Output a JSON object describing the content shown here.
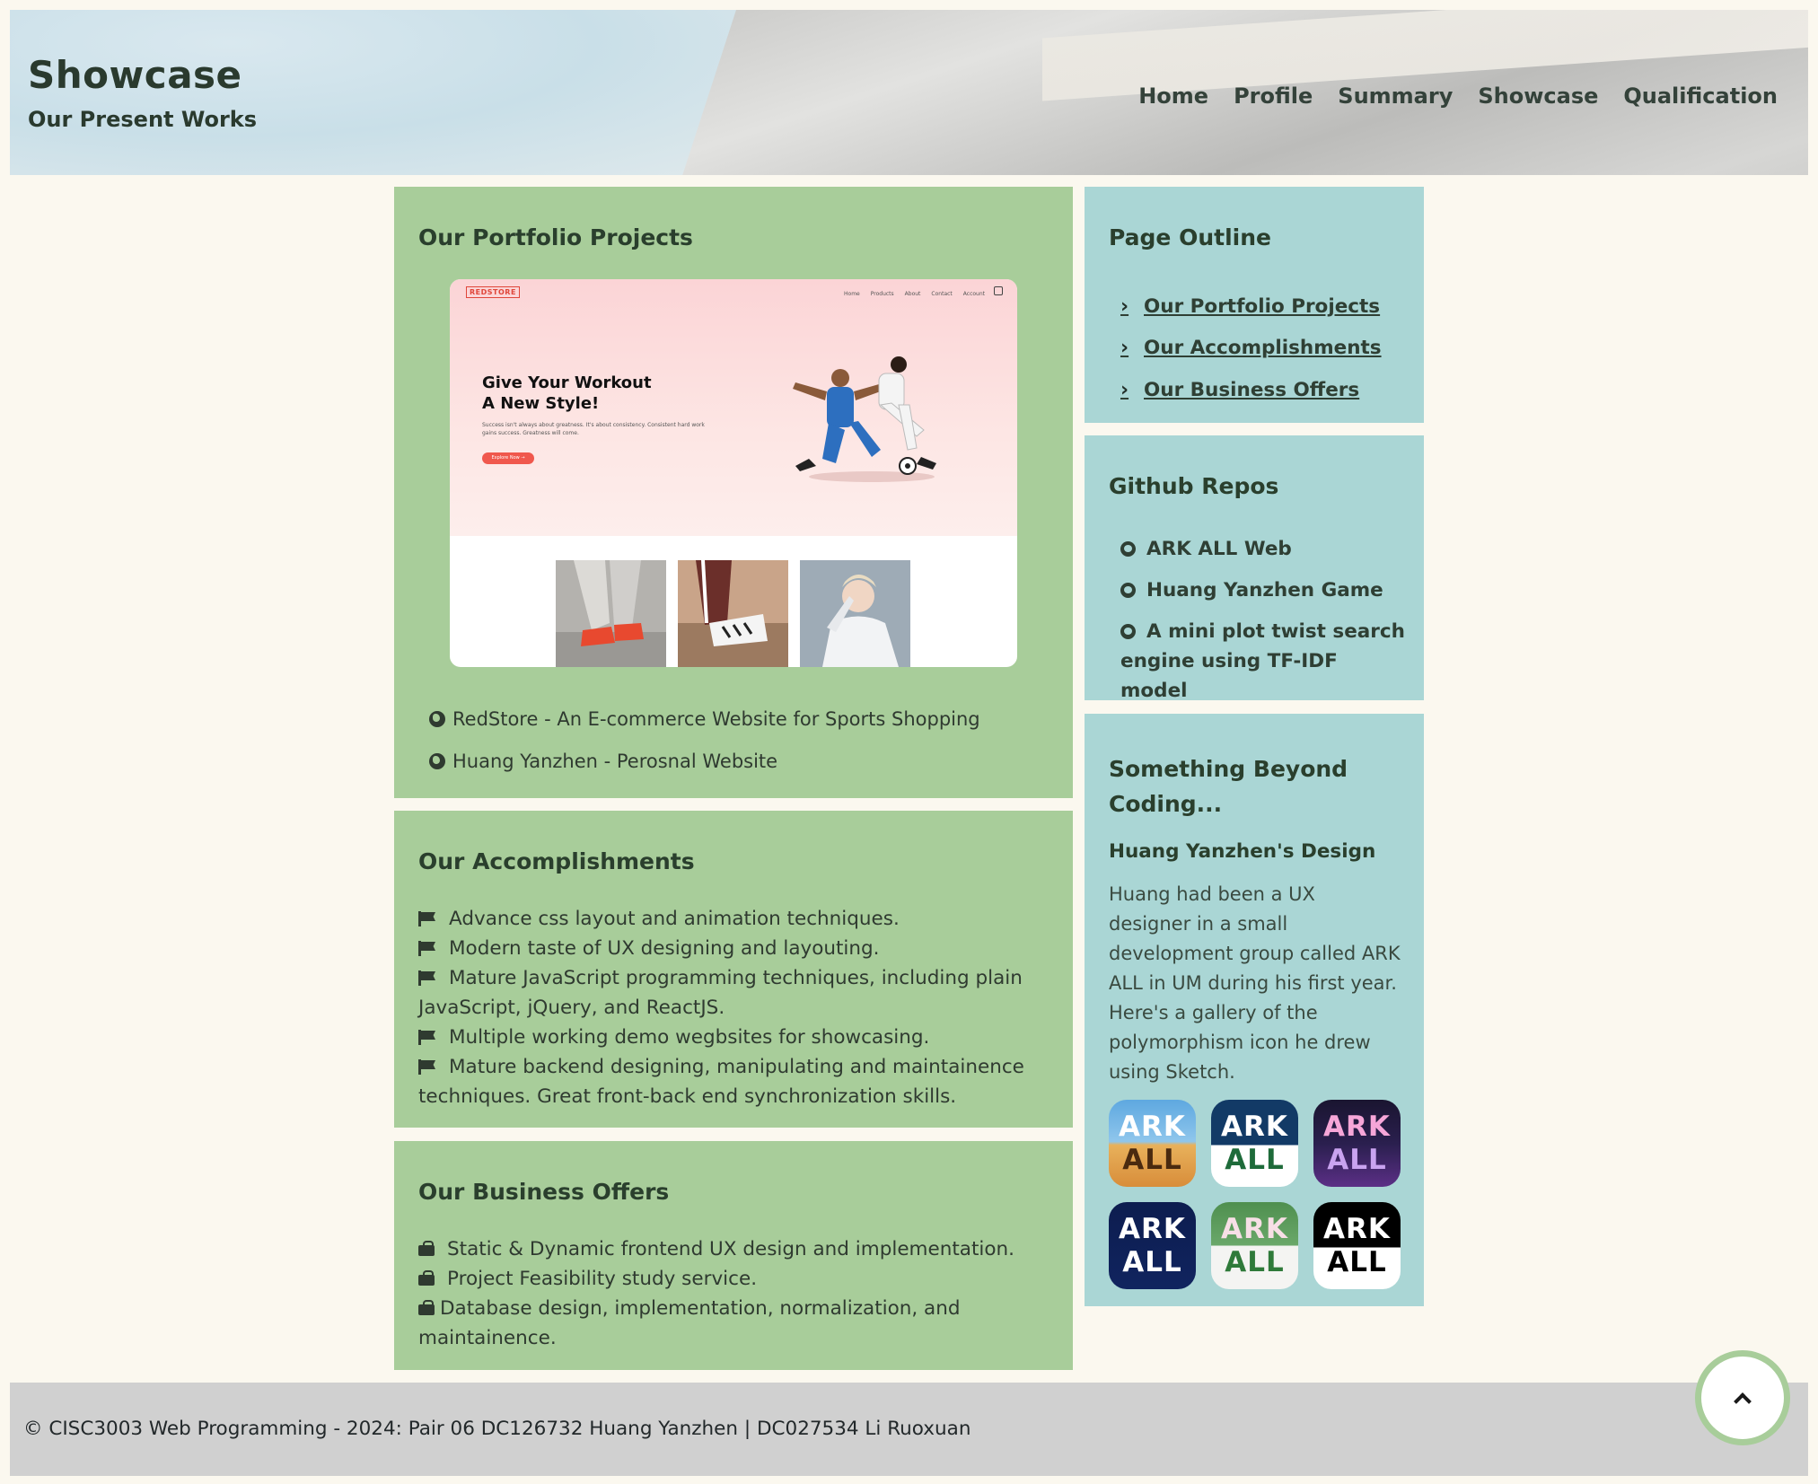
{
  "header": {
    "title": "Showcase",
    "subtitle": "Our Present Works",
    "nav": [
      "Home",
      "Profile",
      "Summary",
      "Showcase",
      "Qualification"
    ]
  },
  "portfolio": {
    "title": "Our Portfolio Projects",
    "mockup": {
      "logo": "REDSTORE",
      "nav": [
        "Home",
        "Products",
        "About",
        "Contact",
        "Account"
      ],
      "headline_line1": "Give Your Workout",
      "headline_line2": "A New Style!",
      "copy": "Success isn't always about greatness. It's about consistency. Consistent hard work gains success. Greatness will come.",
      "button": "Explore Now →"
    },
    "links": [
      "RedStore - An E-commerce Website for Sports Shopping",
      "Huang Yanzhen - Perosnal Website"
    ]
  },
  "accomplishments": {
    "title": "Our Accomplishments",
    "items": [
      "Advance css layout and animation techniques.",
      "Modern taste of UX designing and layouting.",
      "Mature JavaScript programming techniques, including plain JavaScript, jQuery, and ReactJS.",
      "Multiple working demo wegbsites for showcasing.",
      "Mature backend designing, manipulating and maintainence techniques. Great front-back end synchronization skills."
    ]
  },
  "business": {
    "title": "Our Business Offers",
    "items": [
      "Static & Dynamic frontend UX design and implementation.",
      "Project Feasibility study service.",
      "Database design, implementation, normalization, and maintainence."
    ]
  },
  "outline": {
    "title": "Page Outline",
    "items": [
      "Our Portfolio Projects",
      "Our Accomplishments",
      "Our Business Offers"
    ]
  },
  "github": {
    "title": "Github Repos",
    "repos": [
      "ARK ALL Web",
      "Huang Yanzhen Game",
      "A mini plot twist search engine using TF-IDF model"
    ]
  },
  "beyond": {
    "title": "Something Beyond Coding...",
    "design_title": "Huang Yanzhen's Design",
    "design_text": "Huang had been a UX designer in a small development group called ARK ALL in UM during his first year. Here's a gallery of the polymorphism icon he drew using Sketch.",
    "icons": [
      {
        "top": "ARK",
        "bottom": "ALL"
      },
      {
        "top": "ARK",
        "bottom": "ALL"
      },
      {
        "top": "ARK",
        "bottom": "ALL"
      },
      {
        "top": "ARK",
        "bottom": "ALL"
      },
      {
        "top": "ARK",
        "bottom": "ALL"
      },
      {
        "top": "ARK",
        "bottom": "ALL"
      }
    ]
  },
  "footer": {
    "text": "© CISC3003 Web Programming - 2024: Pair 06 DC126732 Huang Yanzhen | DC027534 Li Ruoxuan"
  },
  "colors": {
    "page_bg": "#fbf8ef",
    "green_panel": "#a8cd9a",
    "blue_panel": "#aad6d5",
    "footer_bg": "#d0d0d0"
  }
}
